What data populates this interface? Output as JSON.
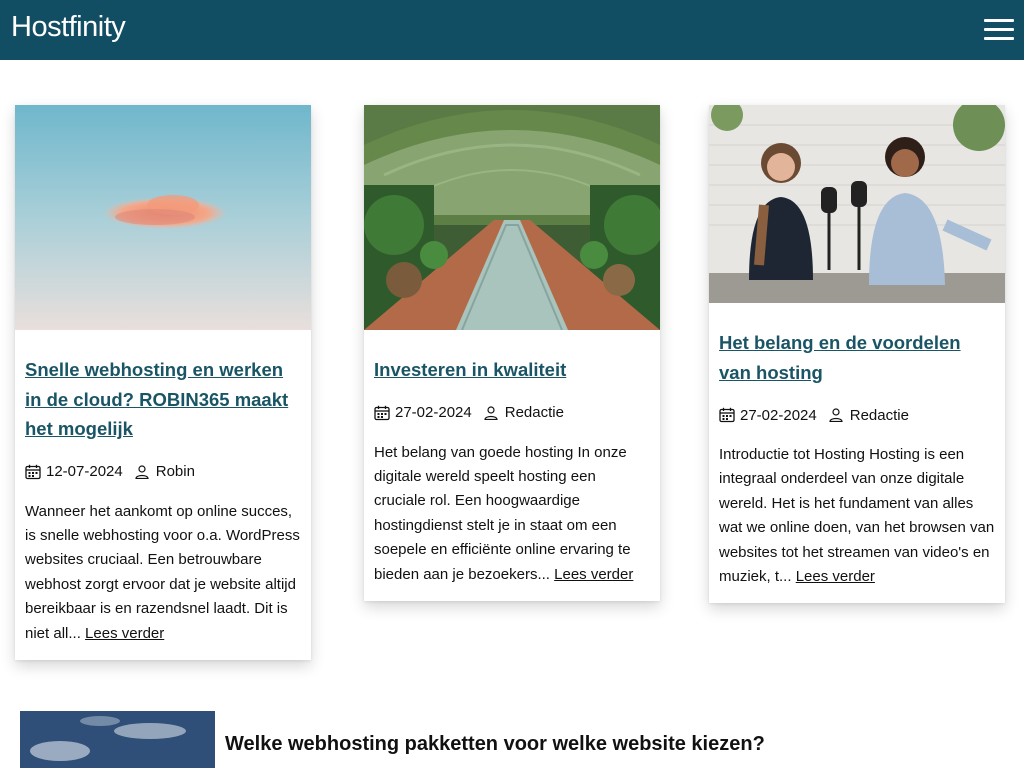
{
  "header": {
    "logo": "Hostfinity",
    "menu_icon": "hamburger-menu-icon"
  },
  "colors": {
    "header_bg": "#124e63",
    "link": "#1a5566"
  },
  "articles": [
    {
      "image": "sky-with-pink-cloud",
      "title": "Snelle webhosting en werken in de cloud? ROBIN365 maakt het mogelijk",
      "date": "12-07-2024",
      "author": "Robin",
      "excerpt": "Wanneer het aankomt op online succes, is snelle webhosting voor o.a. WordPress websites cruciaal. Een betrouwbare webhost zorgt ervoor dat je website altijd bereikbaar is en razendsnel laadt. Dit is niet all...",
      "read_more": "Lees verder"
    },
    {
      "image": "greenhouse-long-table",
      "title": "Investeren in kwaliteit",
      "date": "27-02-2024",
      "author": "Redactie",
      "excerpt": "Het belang van goede hosting In onze digitale wereld speelt hosting een cruciale rol. Een hoogwaardige hostingdienst stelt je in staat om een soepele en efficiënte online ervaring te bieden aan je bezoekers...",
      "read_more": "Lees verder"
    },
    {
      "image": "two-women-podcast",
      "title": "Het belang en de voordelen van hosting",
      "date": "27-02-2024",
      "author": "Redactie",
      "excerpt": "Introductie tot Hosting Hosting is een integraal onderdeel van onze digitale wereld. Het is het fundament van alles wat we online doen, van het browsen van websites tot het streamen van video's en muziek, t...",
      "read_more": "Lees verder"
    }
  ],
  "featured": {
    "image": "blue-sky-clouds",
    "title": "Welke webhosting pakketten voor welke website kiezen?"
  }
}
